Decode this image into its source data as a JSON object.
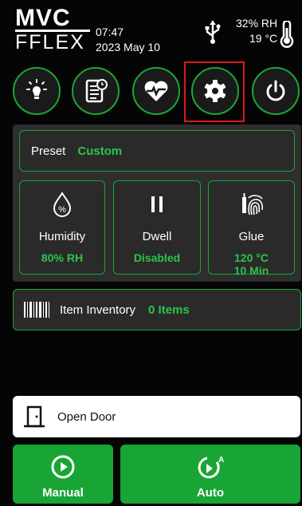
{
  "header": {
    "logo_top": "MVC",
    "logo_bottom": "FFLEX",
    "time": "07:47",
    "date": "2023 May 10",
    "humidity": "32% RH",
    "temperature": "19 °C"
  },
  "nav": [
    {
      "name": "lightbulb",
      "active": false
    },
    {
      "name": "checklist",
      "active": false
    },
    {
      "name": "health",
      "active": false
    },
    {
      "name": "settings",
      "active": true
    },
    {
      "name": "power",
      "active": false
    }
  ],
  "preset": {
    "label": "Preset",
    "value": "Custom"
  },
  "cards": {
    "humidity": {
      "label": "Humidity",
      "value": "80% RH"
    },
    "dwell": {
      "label": "Dwell",
      "value": "Disabled"
    },
    "glue": {
      "label": "Glue",
      "value_line1": "120 °C",
      "value_line2": "10 Min"
    }
  },
  "inventory": {
    "label": "Item Inventory",
    "value": "0 Items"
  },
  "open_door": {
    "label": "Open Door"
  },
  "actions": {
    "manual": "Manual",
    "auto": "Auto"
  },
  "colors": {
    "accent": "#1aa636",
    "highlight": "#e01818",
    "panel": "#2e2e2e"
  }
}
